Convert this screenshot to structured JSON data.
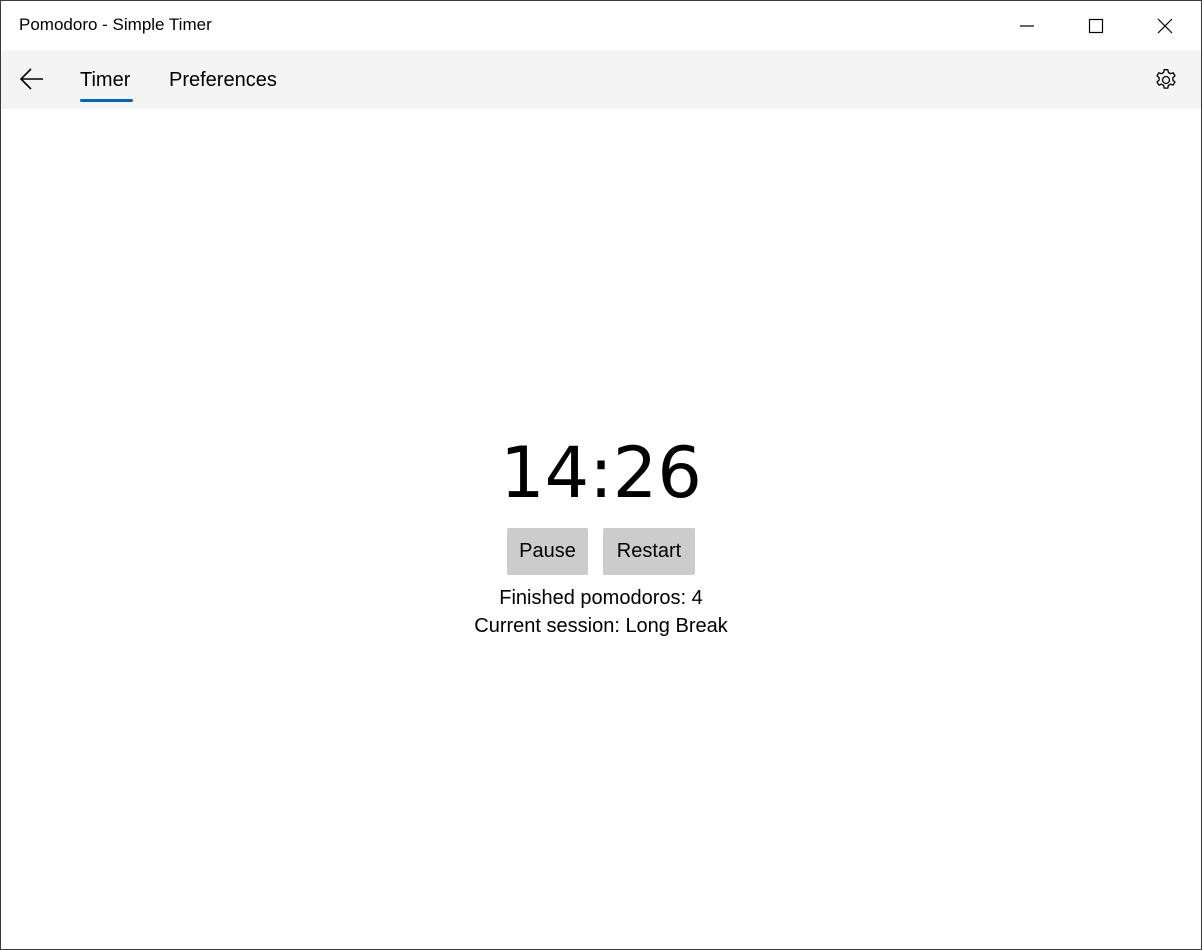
{
  "window": {
    "title": "Pomodoro - Simple Timer",
    "controls": {
      "minimize_icon": "minimize-icon",
      "maximize_icon": "maximize-icon",
      "close_icon": "close-icon"
    }
  },
  "nav": {
    "back_icon": "back-arrow-icon",
    "tabs": [
      {
        "label": "Timer",
        "selected": true
      },
      {
        "label": "Preferences",
        "selected": false
      }
    ],
    "settings_icon": "gear-icon",
    "accent_color": "#0067c0"
  },
  "timer": {
    "display": "14:26",
    "pause_label": "Pause",
    "restart_label": "Restart",
    "finished_text": "Finished pomodoros: 4",
    "session_text": "Current session: Long Break"
  }
}
